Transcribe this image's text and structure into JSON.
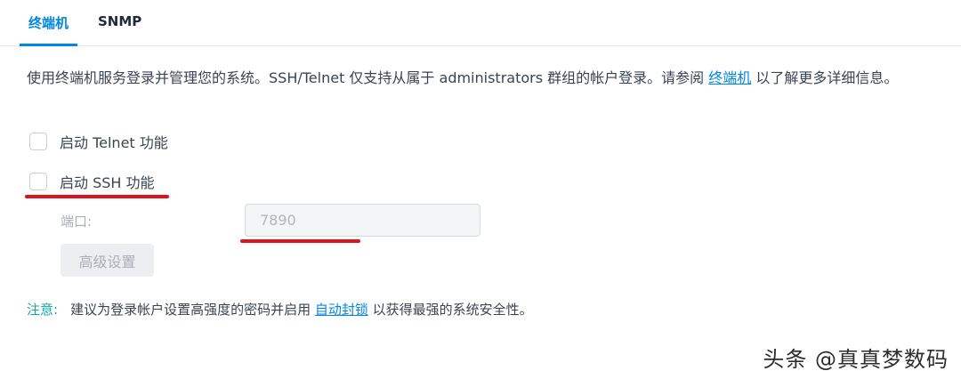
{
  "tabs": [
    {
      "label": "终端机",
      "active": true
    },
    {
      "label": "SNMP",
      "active": false
    }
  ],
  "description": {
    "text_before": "使用终端机服务登录并管理您的系统。SSH/Telnet 仅支持从属于 administrators 群组的帐户登录。请参阅 ",
    "link": "终端机",
    "text_after": " 以了解更多详细信息。"
  },
  "telnet": {
    "label": "启动 Telnet 功能",
    "checked": false
  },
  "ssh": {
    "label": "启动 SSH 功能",
    "checked": false
  },
  "port": {
    "label": "端口:",
    "value": "7890"
  },
  "advanced_button": "高级设置",
  "note": {
    "label": "注意:",
    "text_before": "建议为登录帐户设置高强度的密码并启用 ",
    "link": "自动封锁",
    "text_after": " 以获得最强的系统安全性。"
  },
  "watermark": "头条 @真真梦数码",
  "colors": {
    "accent": "#0086e5",
    "note": "#14a6a0",
    "highlight": "#e0121e"
  }
}
